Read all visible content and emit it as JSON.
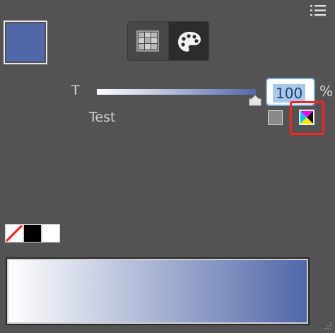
{
  "panel": {
    "menu_icon": "menu-lines-icon",
    "fill_color": "#5067a8"
  },
  "mode_buttons": {
    "grid_icon": "grid-icon",
    "palette_icon": "palette-icon",
    "active": "palette"
  },
  "tint": {
    "label": "T",
    "value": "100",
    "unit": "%",
    "slider_level_percent": 100
  },
  "color_name": "Test",
  "color_type_icons": [
    "gray-swatch-icon",
    "cmyk-icon"
  ],
  "presets": [
    "none-swatch",
    "black-swatch",
    "white-swatch"
  ],
  "ramp": {
    "from_color": "#ffffff",
    "to_color": "#5067a8"
  }
}
